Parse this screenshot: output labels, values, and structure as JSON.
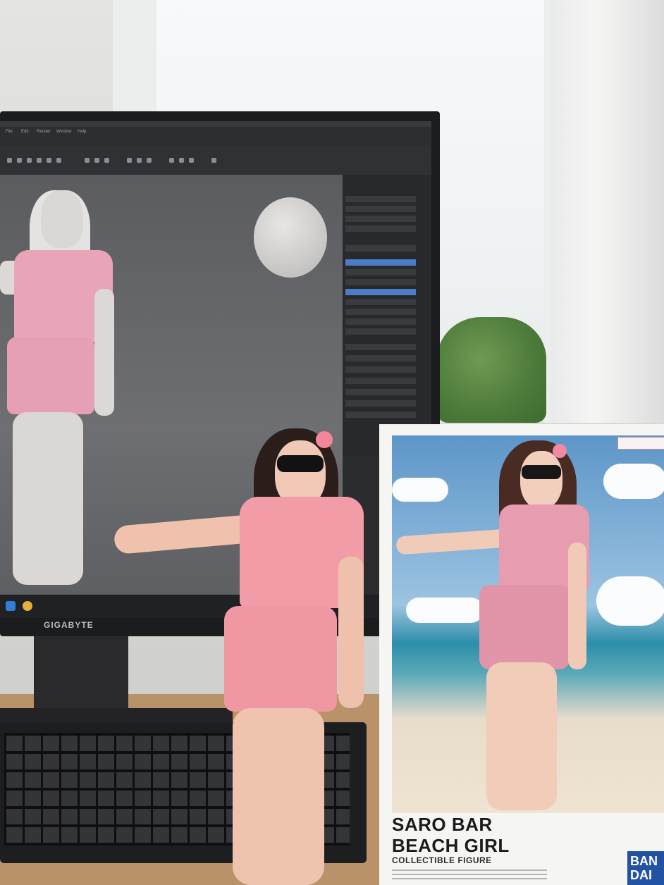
{
  "monitor": {
    "brand": "GIGABYTE",
    "menu_items": [
      "File",
      "Edit",
      "Render",
      "Window",
      "Help"
    ],
    "taskbar_icons": [
      "windows-icon",
      "chrome-icon"
    ]
  },
  "box": {
    "title_line1": "SARO BAR",
    "title_line2": "BEACH GIRL",
    "subtitle": "COLLECTIBLE FIGURE",
    "logo_line1": "BAN",
    "logo_line2": "DAI"
  },
  "colors": {
    "pink_outfit": "#f19ca6",
    "screen_bg": "#393a3d",
    "selection": "#4b7cc8",
    "logo_blue": "#2152a3"
  }
}
